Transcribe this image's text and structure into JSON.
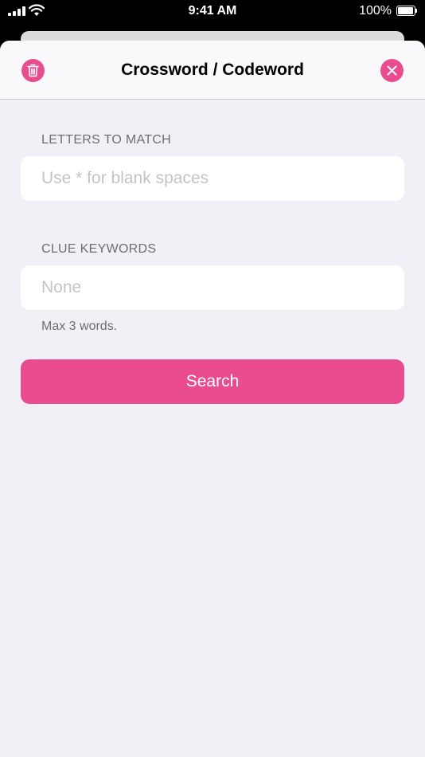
{
  "status_bar": {
    "time": "9:41 AM",
    "battery_percent": "100%"
  },
  "colors": {
    "accent": "#e94d8f",
    "background": "#f1f0f6",
    "label": "#6d6d72",
    "placeholder": "#c4c4c7"
  },
  "header": {
    "title": "Crossword / Codeword",
    "left_icon": "trash-icon",
    "right_icon": "close-icon"
  },
  "letters_section": {
    "label": "LETTERS TO MATCH",
    "value": "",
    "placeholder": "Use * for blank spaces"
  },
  "keywords_section": {
    "label": "CLUE KEYWORDS",
    "value": "",
    "placeholder": "None",
    "footnote": "Max 3 words."
  },
  "search_button": {
    "label": "Search"
  }
}
